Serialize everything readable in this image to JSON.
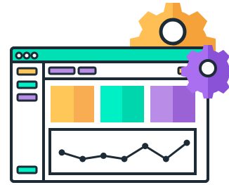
{
  "illustration": {
    "subject": "dashboard-settings-illustration",
    "colors": {
      "outline": "#1d2b36",
      "window_bar": "#00e0b4",
      "window_bg": "#ffffff",
      "yellow": "#ffc758",
      "yellow_shade": "#f8ad52",
      "teal": "#00f0c5",
      "teal_shade": "#00d6ad",
      "purple": "#b98ce8",
      "purple_shade": "#9b62d6",
      "gear_orange": "#ffb94f",
      "gear_orange_shade": "#f5a23a",
      "gear_purple": "#a96ff0",
      "gear_purple_shade": "#8a52d6"
    },
    "icons": [
      "gear-icon-large",
      "gear-icon-small",
      "line-chart-icon",
      "window-dots-icon"
    ],
    "chart_line_points": [
      [
        0,
        0.4
      ],
      [
        1,
        0.0
      ],
      [
        2,
        0.2
      ],
      [
        3,
        0.0
      ],
      [
        4,
        0.8
      ],
      [
        5,
        0.0
      ],
      [
        6,
        1.0
      ]
    ]
  }
}
